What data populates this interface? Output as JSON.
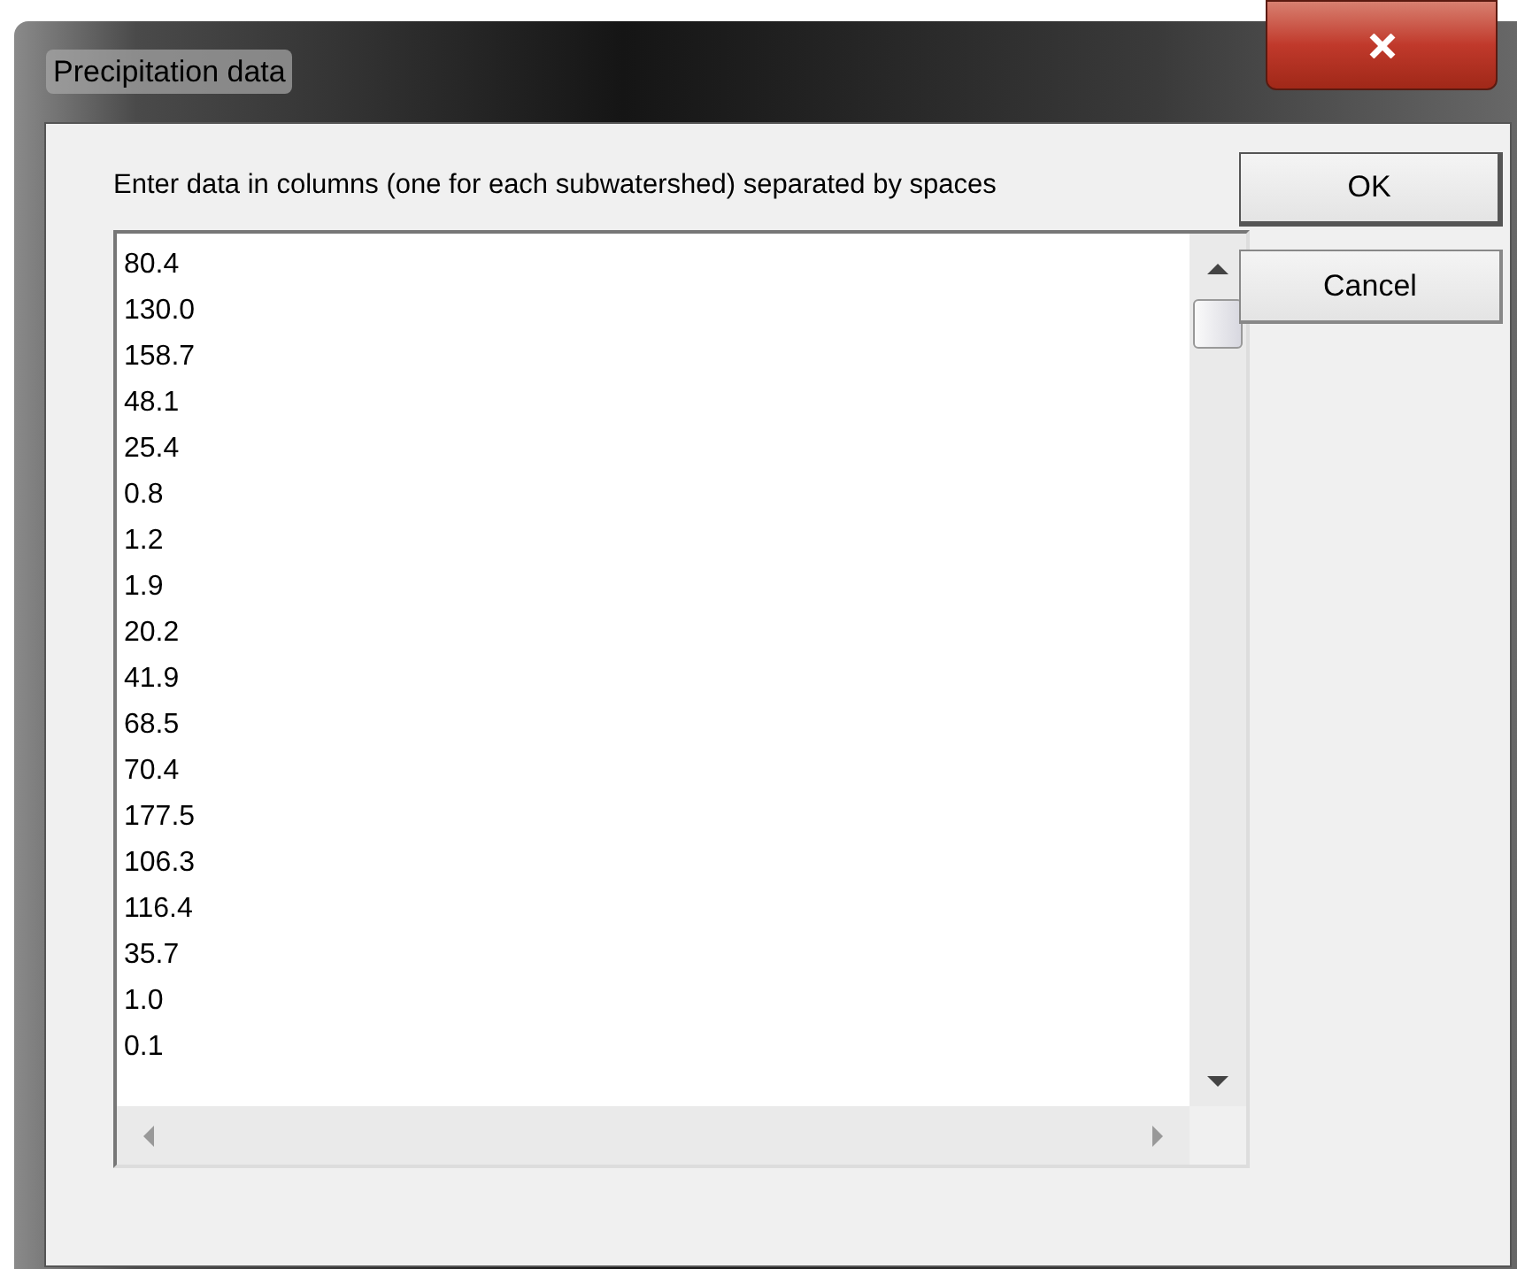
{
  "window": {
    "title": "Precipitation data"
  },
  "instructions": "Enter data in columns (one for each subwatershed) separated by spaces",
  "data_lines": [
    "80.4",
    "130.0",
    "158.7",
    "48.1",
    "25.4",
    "0.8",
    "1.2",
    "1.9",
    "20.2",
    "41.9",
    "68.5",
    "70.4",
    "177.5",
    "106.3",
    "116.4",
    "35.7",
    "1.0",
    "0.1"
  ],
  "buttons": [
    {
      "label": "OK",
      "default": true
    },
    {
      "label": "Cancel",
      "default": false
    }
  ]
}
